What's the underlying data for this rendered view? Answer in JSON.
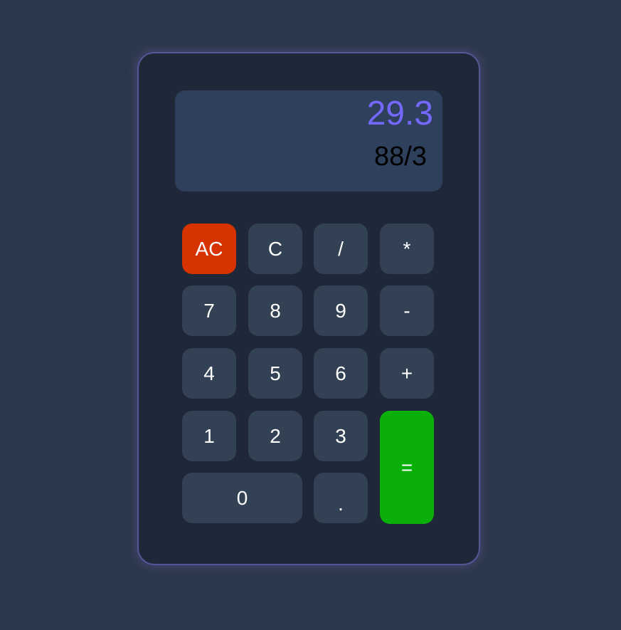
{
  "display": {
    "result": "29.3",
    "expression": "88/3"
  },
  "keys": {
    "ac": "AC",
    "c": "C",
    "divide": "/",
    "multiply": "*",
    "seven": "7",
    "eight": "8",
    "nine": "9",
    "minus": "-",
    "four": "4",
    "five": "5",
    "six": "6",
    "plus": "+",
    "one": "1",
    "two": "2",
    "three": "3",
    "equals": "=",
    "zero": "0",
    "dot": "."
  },
  "colors": {
    "background": "#2c384b",
    "panel": "#1f2839",
    "display": "#2e405c",
    "result_text": "#7468ff",
    "key": "#334155",
    "clear_all": "#d63300",
    "equals": "#0aaf0a"
  }
}
